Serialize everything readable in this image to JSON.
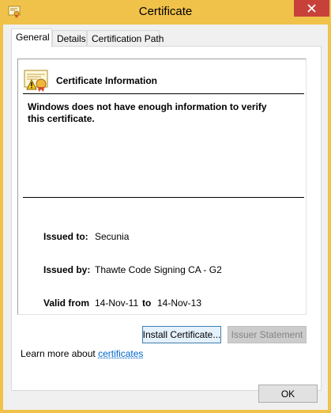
{
  "window": {
    "title": "Certificate",
    "frame_color": "#f0c24a",
    "close_color": "#c7413a"
  },
  "tabs": [
    {
      "label": "General",
      "active": true
    },
    {
      "label": "Details",
      "active": false
    },
    {
      "label": "Certification Path",
      "active": false
    }
  ],
  "info": {
    "heading": "Certificate Information",
    "warning": "Windows does not have enough information to verify this certificate."
  },
  "fields": {
    "issued_to_label": "Issued to:",
    "issued_to_value": "Secunia",
    "issued_by_label": "Issued by:",
    "issued_by_value": "Thawte Code Signing CA - G2",
    "valid_from_label": "Valid from",
    "valid_from_value": "14-Nov-11",
    "to_label": "to",
    "valid_to_value": "14-Nov-13"
  },
  "buttons": {
    "install": "Install Certificate...",
    "issuer_statement": "Issuer Statement",
    "ok": "OK"
  },
  "learn_more": {
    "prefix": "Learn more about ",
    "link": "certificates"
  },
  "icons": {
    "title": "certificate-icon",
    "close": "close-icon",
    "cert": "certificate-warning-icon"
  }
}
